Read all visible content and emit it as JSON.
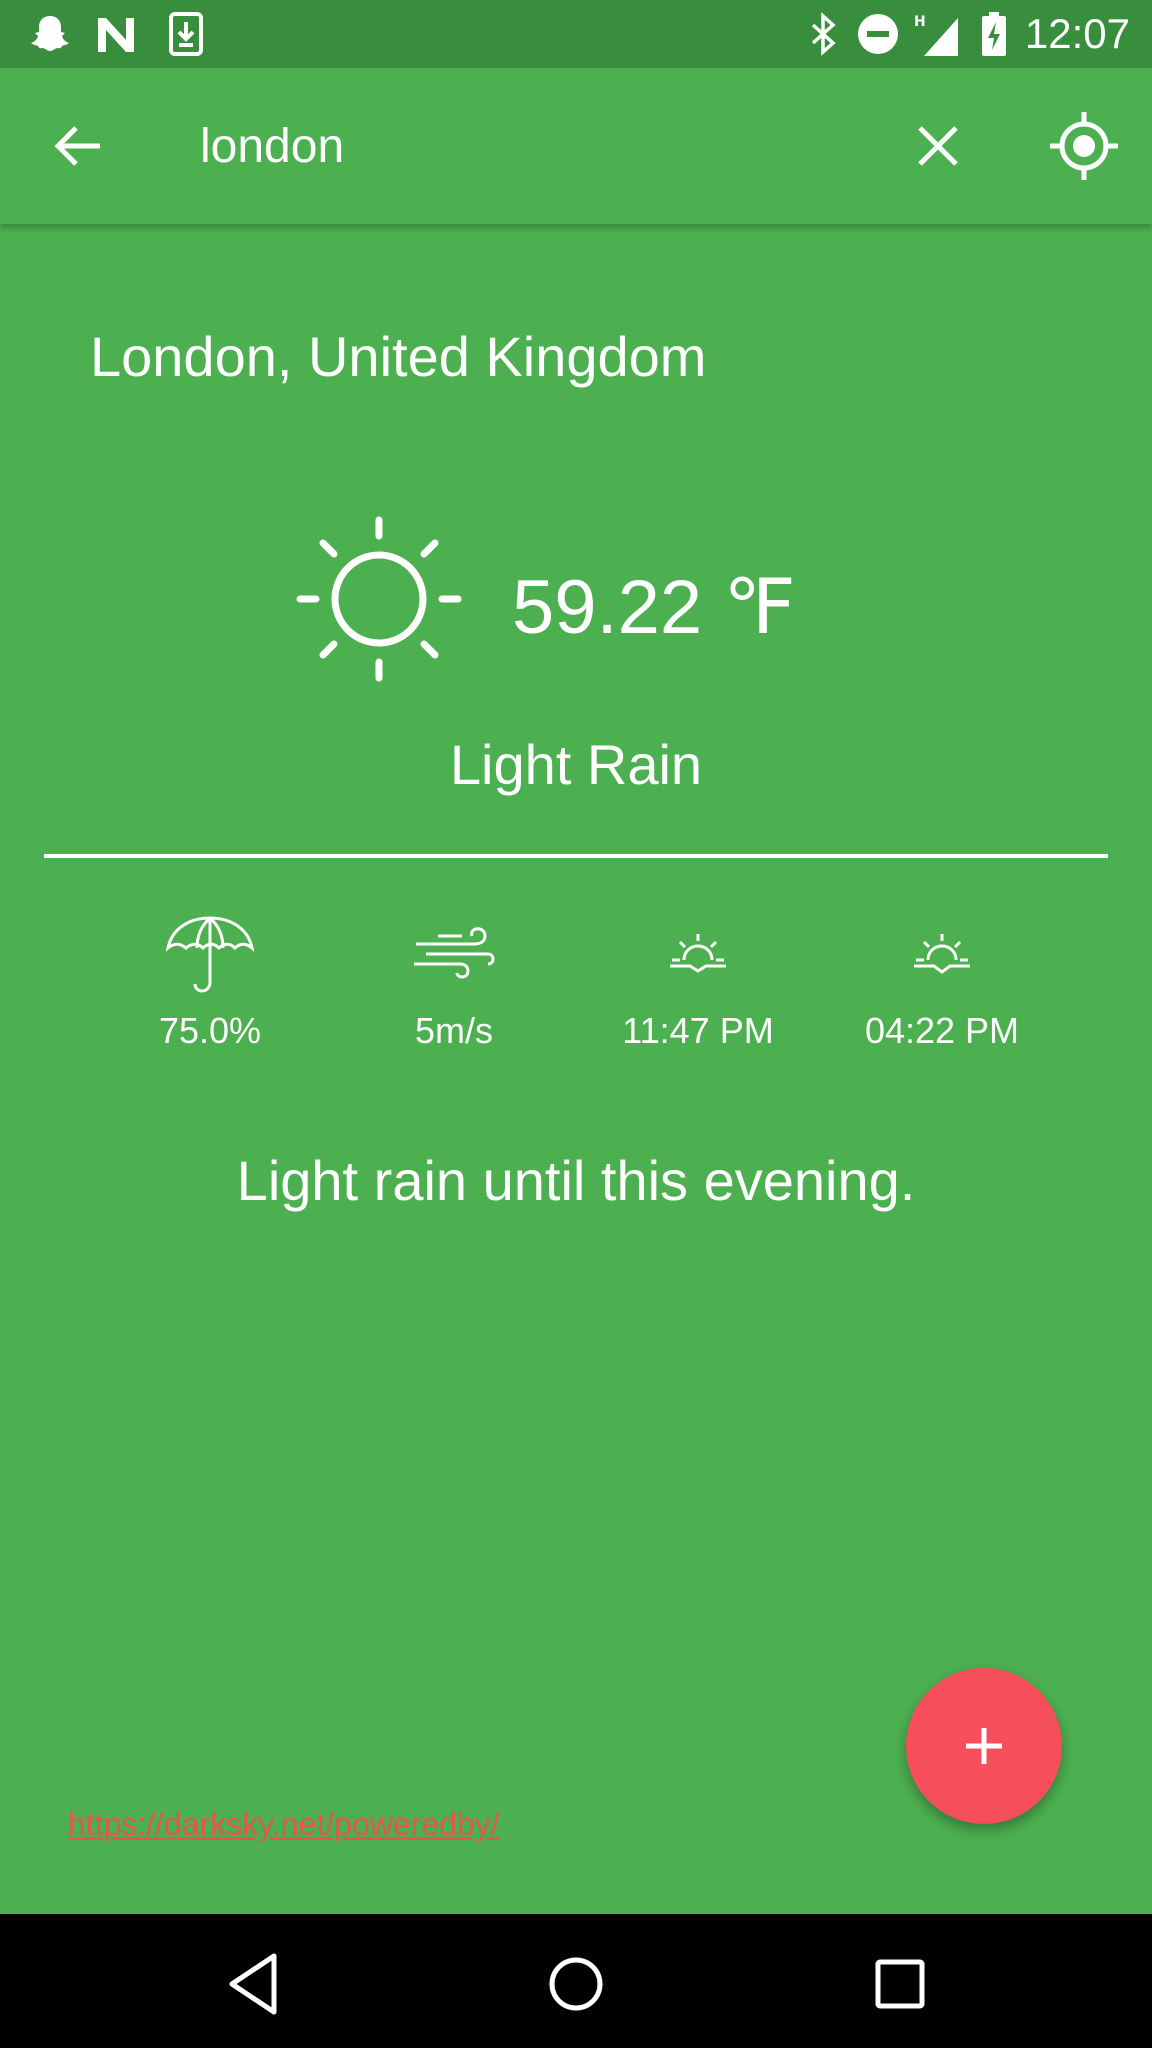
{
  "status_bar": {
    "time": "12:07",
    "left_icons": [
      "snapchat-icon",
      "n-logo-icon",
      "download-icon"
    ],
    "right_icons": [
      "bluetooth-icon",
      "do-not-disturb-icon",
      "signal-h-icon",
      "battery-charging-icon"
    ]
  },
  "app_bar": {
    "search_value": "london",
    "back_icon": "arrow-back-icon",
    "clear_icon": "close-icon",
    "locate_icon": "my-location-icon"
  },
  "weather": {
    "location": "London, United Kingdom",
    "temperature": "59.22 ℉",
    "summary": "Light Rain",
    "icon": "sun-icon",
    "details": [
      {
        "icon": "umbrella-icon",
        "value": "75.0%"
      },
      {
        "icon": "wind-icon",
        "value": "5m/s"
      },
      {
        "icon": "sunrise-icon",
        "value": "11:47 PM"
      },
      {
        "icon": "sunset-icon",
        "value": "04:22 PM"
      }
    ],
    "daily_summary": "Light rain until this evening."
  },
  "footer": {
    "powered_by_link": "https://darksky.net/poweredby/"
  },
  "colors": {
    "primary": "#4caf50",
    "primary_dark": "#388e3c",
    "accent": "#f44f5a",
    "link": "#e8554e"
  }
}
